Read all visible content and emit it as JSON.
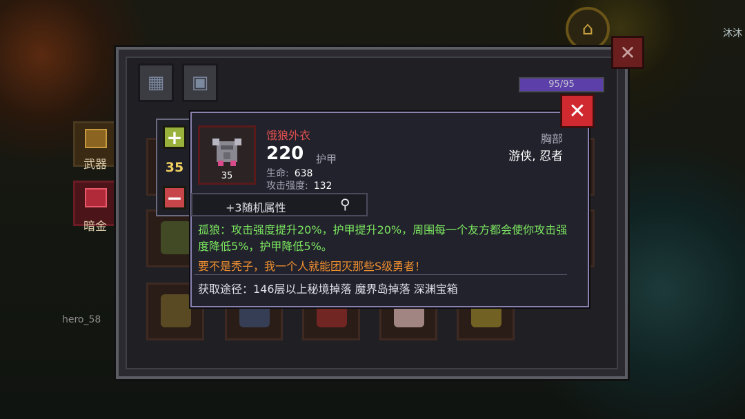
{
  "background": {
    "player_name": "hero_58",
    "corner_text": "沐沐"
  },
  "panel": {
    "hp_text": "95/95",
    "hp_fraction": 1.0,
    "close_symbol": "✕"
  },
  "sidebar": {
    "items": [
      {
        "label": "武器"
      },
      {
        "label": "暗金"
      }
    ]
  },
  "stepper": {
    "plus": "+",
    "minus": "−",
    "value": "35"
  },
  "item": {
    "name": "饿狼外衣",
    "level": "35",
    "armor_value": "220",
    "armor_unit": "护甲",
    "stats": [
      {
        "label": "生命:",
        "value": "638"
      },
      {
        "label": "攻击强度:",
        "value": "132"
      }
    ],
    "slot": "胸部",
    "classes": "游侠, 忍者",
    "random_attr": "+3随机属性",
    "effect": "孤狼：攻击强度提升20%，护甲提升20%，周围每一个友方都会使你攻击强度降低5%，护甲降低5%。",
    "flavor": "要不是秃子，我一个人就能团灭那些S级勇者！",
    "source": "获取途径：146层以上秘境掉落 魔界岛掉落 深渊宝箱",
    "close_symbol": "✕"
  },
  "colors": {
    "item_name": "#e05050",
    "effect_text": "#7ce860",
    "flavor_text": "#f09030",
    "stepper_value": "#f0d060",
    "close_button": "#d02a30"
  }
}
